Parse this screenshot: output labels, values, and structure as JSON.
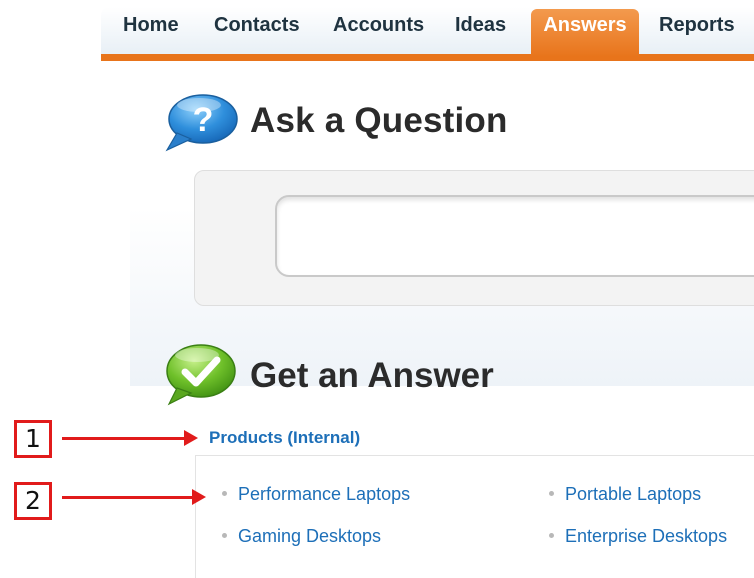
{
  "nav": {
    "tabs": [
      "Home",
      "Contacts",
      "Accounts",
      "Ideas",
      "Answers",
      "Reports"
    ],
    "active_tab": "Answers",
    "accent_color": "#e8741b"
  },
  "ask": {
    "icon": "question-bubble-icon",
    "title": "Ask a Question",
    "search_value": ""
  },
  "answer": {
    "icon": "checkmark-bubble-icon",
    "title": "Get an Answer",
    "category": "Products (Internal)",
    "items": [
      "Performance Laptops",
      "Portable Laptops",
      "Gaming Desktops",
      "Enterprise Desktops"
    ]
  },
  "callouts": [
    "1",
    "2"
  ],
  "colors": {
    "link": "#1d6fb8",
    "callout": "#e11b1b",
    "heading": "#2b2b2b"
  }
}
